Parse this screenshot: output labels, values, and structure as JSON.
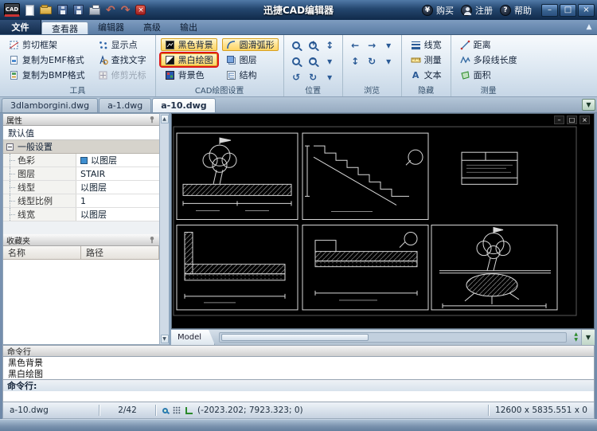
{
  "titlebar": {
    "logo_text": "CAD",
    "title": "迅捷CAD编辑器",
    "buy": "购买",
    "register": "注册",
    "help": "帮助"
  },
  "icons": {
    "undo": "↶",
    "redo": "↷",
    "exit_x": "×",
    "yen": "¥",
    "question": "?",
    "min": "–",
    "max": "□",
    "close": "×",
    "caret_up": "▲",
    "caret_down": "▼",
    "drop": "▼",
    "small_drop": "▾",
    "left": "←",
    "right": "→",
    "updown": "↕",
    "orbit": "↻",
    "rotate": "↺",
    "menu_caret": "▲",
    "text_a": "A",
    "mdi_min": "–",
    "mdi_restore": "□",
    "mdi_close": "×"
  },
  "menu": {
    "file": "文件",
    "tabs": [
      "查看器",
      "编辑器",
      "高级",
      "输出"
    ]
  },
  "ribbon": {
    "tools": {
      "title": "工具",
      "clip_frame": "剪切框架",
      "copy_emf": "复制为EMF格式",
      "copy_bmp": "复制为BMP格式",
      "show_points": "显示点",
      "find_text": "查找文字",
      "trim_cursor": "修剪光标"
    },
    "cad": {
      "title": "CAD绘图设置",
      "black_bg": "黑色背景",
      "smooth_arc": "圆滑弧形",
      "bw_drawing": "黑白绘图",
      "layers": "图层",
      "bg_color": "背景色",
      "structure": "结构"
    },
    "position": {
      "title": "位置"
    },
    "browse": {
      "title": "浏览"
    },
    "hide": {
      "title": "隐藏",
      "line_width": "线宽",
      "measure": "测量",
      "text": "文本"
    },
    "measure": {
      "title": "测量",
      "distance": "距离",
      "polyline_length": "多段线长度",
      "area": "面积"
    }
  },
  "doc_tabs": [
    "3dlamborgini.dwg",
    "a-1.dwg",
    "a-10.dwg"
  ],
  "properties": {
    "title": "属性",
    "default_label": "默认值",
    "group": "一般设置",
    "rows": [
      {
        "label": "色彩",
        "value": "以图层"
      },
      {
        "label": "图层",
        "value": "STAIR"
      },
      {
        "label": "线型",
        "value": "以图层"
      },
      {
        "label": "线型比例",
        "value": "1"
      },
      {
        "label": "线宽",
        "value": "以图层"
      }
    ]
  },
  "favorites": {
    "title": "收藏夹",
    "col_name": "名称",
    "col_path": "路径"
  },
  "canvas": {
    "model_tab": "Model"
  },
  "command": {
    "title": "命令行",
    "history": [
      "黑色背景",
      "黑白绘图"
    ],
    "prompt": "命令行:"
  },
  "statusbar": {
    "file": "a-10.dwg",
    "page": "2/42",
    "coords": "(-2023.202; 7923.323; 0)",
    "dims": "12600 x 5835.551 x 0"
  }
}
